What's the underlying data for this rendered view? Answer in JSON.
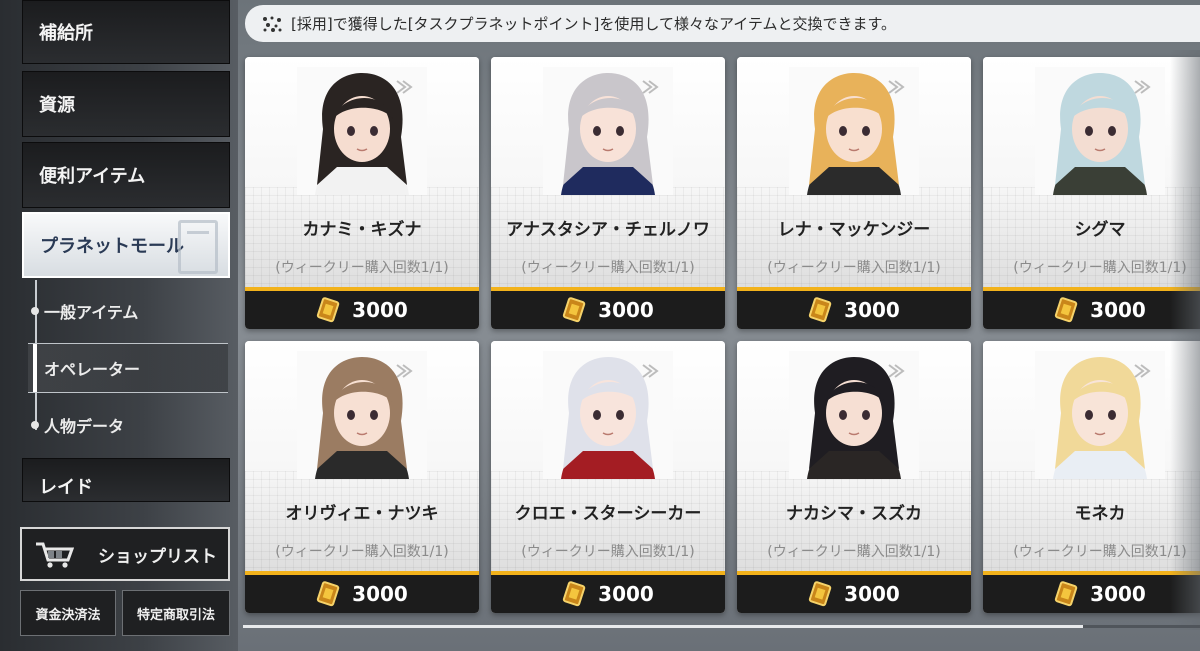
{
  "sidebar": {
    "categories": [
      {
        "label": "補給所"
      },
      {
        "label": "資源"
      },
      {
        "label": "便利アイテム"
      },
      {
        "label": "プラネットモール"
      }
    ],
    "subitems": [
      {
        "label": "一般アイテム"
      },
      {
        "label": "オペレーター"
      },
      {
        "label": "人物データ"
      }
    ],
    "raid_label": "レイド",
    "shoplist_label": "ショップリスト",
    "fund_settlement_label": "資金決済法",
    "commerce_label": "特定商取引法"
  },
  "banner": {
    "text": "[採用]で獲得した[タスクプラネットポイント]を使用して様々なアイテムと交換できます。"
  },
  "cards": [
    {
      "name": "カナミ・キズナ",
      "limit": "(ウィークリー購入回数1/1)",
      "price": "3000",
      "hair": "#2a2422",
      "skin": "#f6ddd0",
      "outfit": "#f2f2f2"
    },
    {
      "name": "アナスタシア・チェルノワ",
      "limit": "(ウィークリー購入回数1/1)",
      "price": "3000",
      "hair": "#c9c6cb",
      "skin": "#f8e2d8",
      "outfit": "#1f2b5e"
    },
    {
      "name": "レナ・マッケンジー",
      "limit": "(ウィークリー購入回数1/1)",
      "price": "3000",
      "hair": "#e8b25a",
      "skin": "#f8dfcf",
      "outfit": "#2b2b2b"
    },
    {
      "name": "シグマ",
      "limit": "(ウィークリー購入回数1/1)",
      "price": "3000",
      "hair": "#bfd8df",
      "skin": "#f3ddd2",
      "outfit": "#3a3f36"
    },
    {
      "name": "オリヴィエ・ナツキ",
      "limit": "(ウィークリー購入回数1/1)",
      "price": "3000",
      "hair": "#9b7c62",
      "skin": "#f7e0d3",
      "outfit": "#2a2a2a"
    },
    {
      "name": "クロエ・スターシーカー",
      "limit": "(ウィークリー購入回数1/1)",
      "price": "3000",
      "hair": "#dfe1ea",
      "skin": "#f8e4dc",
      "outfit": "#a41d23"
    },
    {
      "name": "ナカシマ・スズカ",
      "limit": "(ウィークリー購入回数1/1)",
      "price": "3000",
      "hair": "#1f1d22",
      "skin": "#f6dfd3",
      "outfit": "#2a2625"
    },
    {
      "name": "モネカ",
      "limit": "(ウィークリー購入回数1/1)",
      "price": "3000",
      "hair": "#f1d999",
      "skin": "#f8e4d8",
      "outfit": "#e9eef4"
    }
  ],
  "colors": {
    "accent": "#f2b21b",
    "price_bar": "#1c1c1c"
  },
  "icons": {
    "price": "gold-ticket-icon",
    "banner": "sparkle-dots-icon",
    "shoplist": "shopping-cart-icon"
  }
}
